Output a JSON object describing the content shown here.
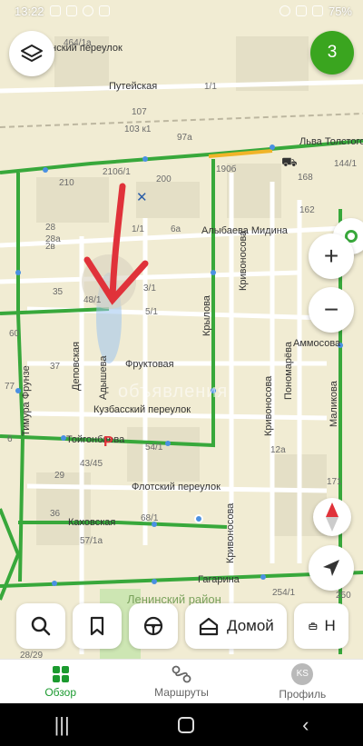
{
  "status_bar": {
    "time": "13:22",
    "battery": "75%"
  },
  "map": {
    "streets": [
      "Гатчинский переулок",
      "Путейская",
      "Льва Толстого",
      "Алыбаева Мидина",
      "Кривоносова",
      "Аммосова",
      "Крылова",
      "Пономарёва",
      "Маликова",
      "Фруктовая",
      "Деповская",
      "Адышева",
      "Кузбасский переулок",
      "Тойгонбаева",
      "Тимура Фрунзе",
      "Флотский переулок",
      "Каховская",
      "Гагарина",
      "Кривоносова",
      "Кривоносова",
      "Ленинский район"
    ],
    "house_numbers": [
      "464/1а",
      "1/1",
      "107",
      "103 к1",
      "97а",
      "210",
      "210б/1",
      "200",
      "190б",
      "168",
      "144/1",
      "162",
      "1/1",
      "6а",
      "28",
      "28а",
      "2в",
      "35",
      "48/1",
      "3/1",
      "5/1",
      "60",
      "37",
      "77",
      "54/1",
      "43/45",
      "29",
      "12а",
      "171",
      "68/1",
      "57/1а",
      "250",
      "254/1",
      "28/29",
      "6",
      "36"
    ],
    "watermark": "объявления",
    "parking_label": "P"
  },
  "controls": {
    "notification_count": "3",
    "zoom_in": "+",
    "zoom_out": "−"
  },
  "quick_bar": {
    "home_label": "Домой",
    "work_label": "Н"
  },
  "tabs": [
    {
      "label": "Обзор"
    },
    {
      "label": "Маршруты"
    },
    {
      "label": "Профиль",
      "avatar": "KS"
    }
  ],
  "colors": {
    "accent": "#1b9a2f",
    "route_green": "#38a83b",
    "map_bg": "#f3efd9",
    "arrow_red": "#e0323a"
  }
}
